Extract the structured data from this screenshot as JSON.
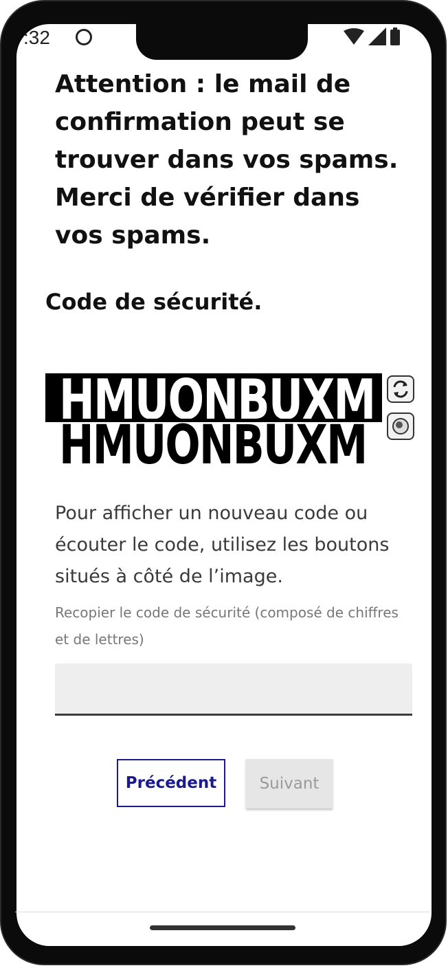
{
  "status_bar": {
    "time": ":32",
    "icons": [
      "alarm-icon",
      "wifi-icon",
      "cellular-icon",
      "battery-icon"
    ]
  },
  "warning": "Attention : le mail de confirmation peut se trouver dans vos spams. Merci de vérifier dans vos spams.",
  "security_title": "Code de sécurité.",
  "captcha": {
    "text_top": "HMUONBUXM",
    "text_bottom": "HMUONBUXM",
    "refresh_icon": "refresh-icon",
    "audio_icon": "audio-icon"
  },
  "help_text": "Pour afficher un nouveau code ou écouter le code, utilisez les boutons situés à côté de l’image.",
  "field_label": "Recopier le code de sécurité (composé de chiffres et de lettres)",
  "input": {
    "value": "",
    "placeholder": ""
  },
  "buttons": {
    "previous": "Précédent",
    "next": "Suivant"
  },
  "colors": {
    "primary": "#1a1a8e",
    "disabled_bg": "#e6e6e6",
    "disabled_text": "#9a9a9a"
  }
}
